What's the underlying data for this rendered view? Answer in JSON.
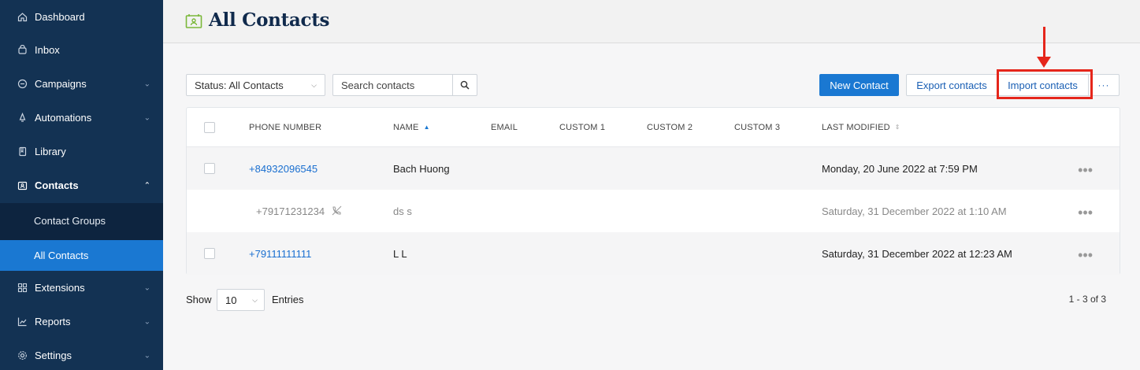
{
  "sidebar": {
    "items": [
      {
        "label": "Dashboard",
        "icon": "home-icon"
      },
      {
        "label": "Inbox",
        "icon": "inbox-icon"
      },
      {
        "label": "Campaigns",
        "icon": "campaigns-icon",
        "expandable": true
      },
      {
        "label": "Automations",
        "icon": "automations-icon",
        "expandable": true
      },
      {
        "label": "Library",
        "icon": "library-icon"
      },
      {
        "label": "Contacts",
        "icon": "contacts-icon",
        "expanded": true
      },
      {
        "label": "Extensions",
        "icon": "extensions-icon",
        "expandable": true
      },
      {
        "label": "Reports",
        "icon": "reports-icon",
        "expandable": true
      },
      {
        "label": "Settings",
        "icon": "settings-icon",
        "expandable": true
      }
    ],
    "contacts_submenu": [
      {
        "label": "Contact Groups"
      },
      {
        "label": "All Contacts",
        "active": true
      }
    ]
  },
  "header": {
    "title": "All Contacts",
    "icon": "contacts-card-icon"
  },
  "toolbar": {
    "status_select": "Status: All Contacts",
    "search_placeholder": "Search contacts",
    "new_contact_label": "New Contact",
    "export_label": "Export contacts",
    "import_label": "Import contacts",
    "more_label": "···"
  },
  "table": {
    "columns": [
      "PHONE NUMBER",
      "NAME",
      "EMAIL",
      "CUSTOM 1",
      "CUSTOM 2",
      "CUSTOM 3",
      "LAST MODIFIED"
    ],
    "rows": [
      {
        "phone": "+84932096545",
        "name": "Bach Huong",
        "email": "",
        "custom1": "",
        "custom2": "",
        "custom3": "",
        "modified": "Monday, 20 June 2022 at 7:59 PM"
      },
      {
        "phone": "+79171231234",
        "name": "ds s",
        "email": "",
        "custom1": "",
        "custom2": "",
        "custom3": "",
        "modified": "Saturday, 31 December 2022 at 1:10 AM",
        "unsubscribed": true
      },
      {
        "phone": "+79111111111",
        "name": "L L",
        "email": "",
        "custom1": "",
        "custom2": "",
        "custom3": "",
        "modified": "Saturday, 31 December 2022 at 12:23 AM"
      }
    ]
  },
  "footer": {
    "show_label": "Show",
    "page_size": "10",
    "entries_label": "Entries",
    "pagination": "1 - 3 of 3"
  },
  "colors": {
    "sidebar_bg": "#133253",
    "accent": "#1a78d2",
    "annotation": "#e5261b"
  }
}
